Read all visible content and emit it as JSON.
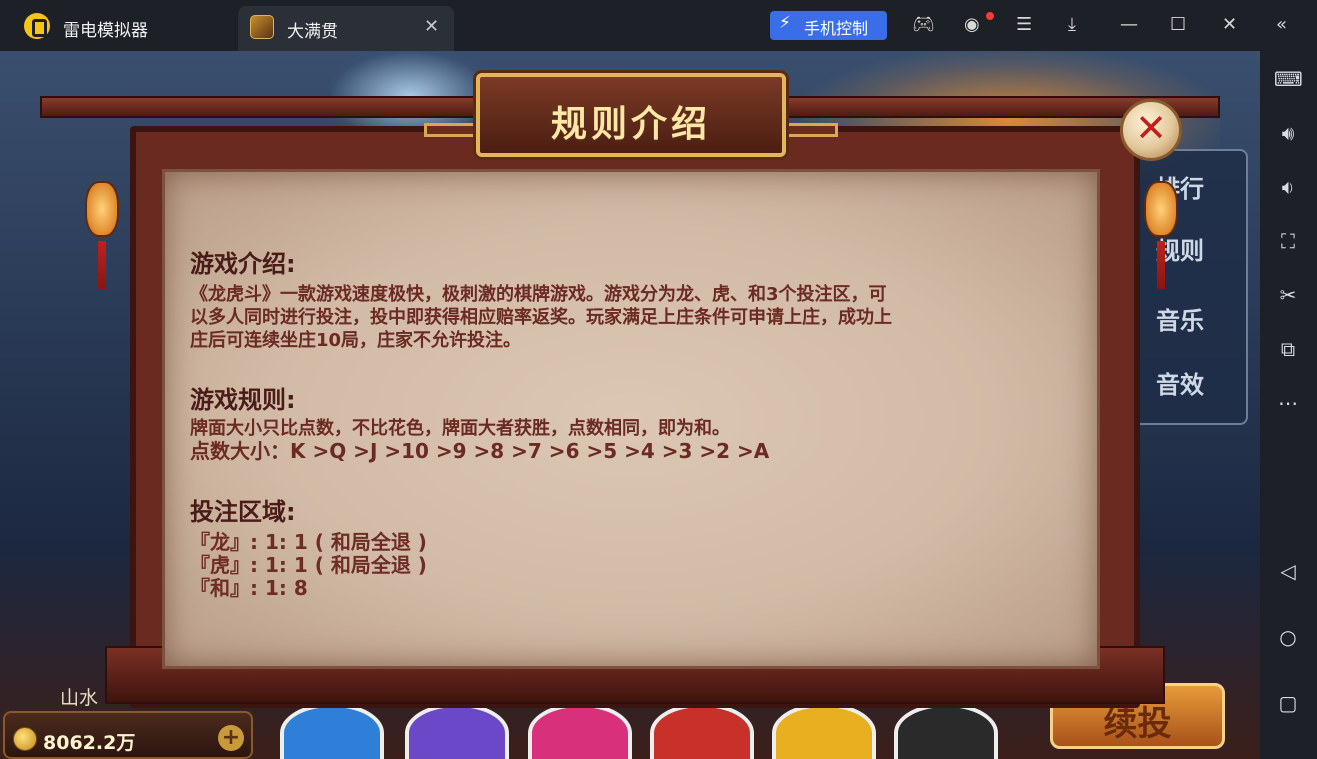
{
  "titlebar": {
    "app_name": "雷电模拟器",
    "tab_title": "大满贯",
    "phone_control": "手机控制"
  },
  "game": {
    "dialog_title": "规则介绍",
    "side_menu": [
      "排行",
      "规则",
      "音乐",
      "音效"
    ],
    "room_label": "山水",
    "balance": "8062.2万",
    "continue_label": "续投"
  },
  "rules": {
    "intro_title": "游戏介绍:",
    "intro_lines": [
      "《龙虎斗》一款游戏速度极快，极刺激的棋牌游戏。游戏分为龙、虎、和3个投注区，可",
      "以多人同时进行投注，投中即获得相应赔率返奖。玩家满足上庄条件可申请上庄，成功上",
      "庄后可连续坐庄10局，庄家不允许投注。"
    ],
    "rules_title": "游戏规则:",
    "rules_lines": [
      "牌面大小只比点数，不比花色，牌面大者获胜，点数相同，即为和。",
      "点数大小：K >Q >J >10 >9 >8 >7 >6 >5 >4 >3 >2 >A"
    ],
    "bet_title": "投注区域:",
    "bet_lines": [
      "『龙』: 1: 1 ( 和局全退 )",
      "『虎』: 1: 1 ( 和局全退 )",
      "『和』: 1: 8"
    ]
  },
  "colors": {
    "accent_blue": "#3a6ee8",
    "title_gold": "#e2b659",
    "text_brown": "#6b2a22",
    "close_red": "#c0211c"
  }
}
